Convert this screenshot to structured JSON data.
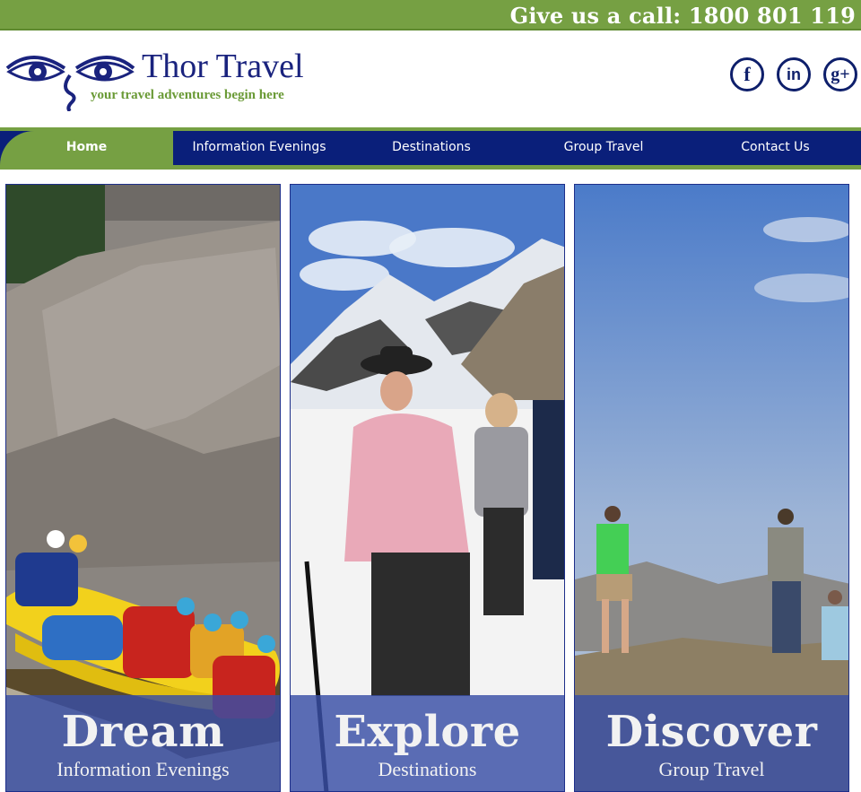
{
  "callbar": {
    "text": "Give us a call: 1800 801 119"
  },
  "logo": {
    "title": "Thor Travel",
    "tagline": "your travel adventures begin here"
  },
  "social": [
    {
      "icon": "facebook-icon",
      "glyph": "f"
    },
    {
      "icon": "linkedin-icon",
      "glyph": "in"
    },
    {
      "icon": "google-plus-icon",
      "glyph": "g+"
    }
  ],
  "nav": [
    {
      "label": "Home",
      "active": true
    },
    {
      "label": "Information Evenings",
      "active": false
    },
    {
      "label": "Destinations",
      "active": false
    },
    {
      "label": "Group Travel",
      "active": false
    },
    {
      "label": "Contact Us",
      "active": false
    }
  ],
  "panels": [
    {
      "title": "Dream",
      "subtitle": "Information Evenings",
      "image": "river-rafting-photo"
    },
    {
      "title": "Explore",
      "subtitle": "Destinations",
      "image": "mountain-hiker-photo"
    },
    {
      "title": "Discover",
      "subtitle": "Group Travel",
      "image": "hilltop-group-photo"
    }
  ],
  "colors": {
    "green": "#76a043",
    "navy": "#0a1f7a",
    "caption_overlay": "#384ea6"
  }
}
